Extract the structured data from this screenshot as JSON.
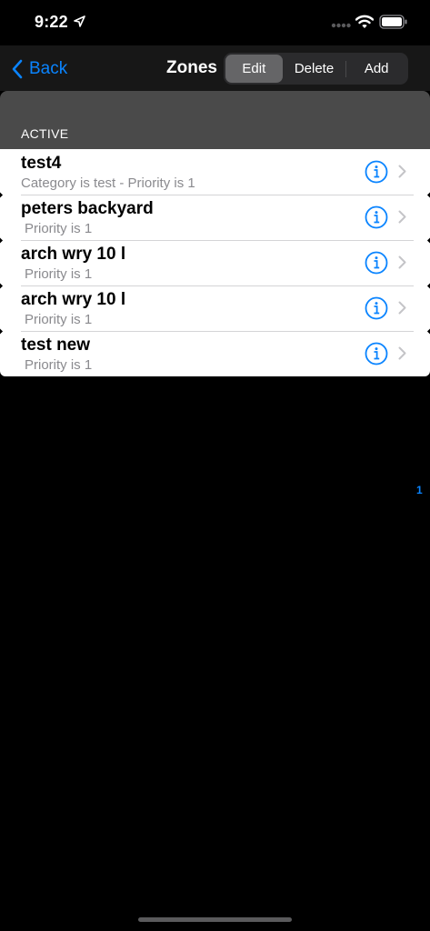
{
  "status_bar": {
    "time": "9:22"
  },
  "nav": {
    "back_label": "Back",
    "title": "Zones",
    "segments": [
      {
        "label": "Edit",
        "selected": true
      },
      {
        "label": "Delete",
        "selected": false
      },
      {
        "label": "Add",
        "selected": false
      }
    ]
  },
  "section": {
    "header": "ACTIVE"
  },
  "zones": [
    {
      "title": "test4",
      "subtitle": "Category is test - Priority is 1"
    },
    {
      "title": "peters backyard",
      "subtitle": " Priority is 1"
    },
    {
      "title": "arch wry 10 l",
      "subtitle": " Priority is 1"
    },
    {
      "title": "arch wry 10 l",
      "subtitle": " Priority is 1"
    },
    {
      "title": "test new",
      "subtitle": " Priority is 1"
    }
  ],
  "index_marker": "1",
  "colors": {
    "accent": "#0a84ff",
    "nav_background": "#171717",
    "section_band": "#4a4a4a",
    "row_background": "#ffffff",
    "subtitle": "#8a8a8e"
  },
  "icons": {
    "location": "location-arrow-icon",
    "signal": "cellular-signal-icon",
    "wifi": "wifi-icon",
    "battery": "battery-icon",
    "back": "chevron-left-icon",
    "info": "info-circle-icon",
    "disclosure": "chevron-right-icon"
  }
}
